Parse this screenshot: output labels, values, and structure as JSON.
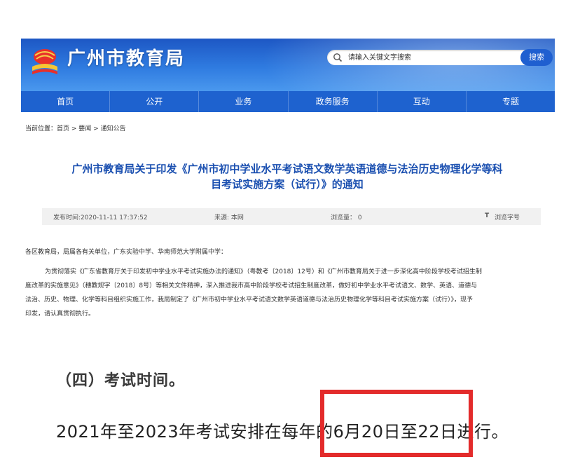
{
  "header": {
    "site_title": "广州市教育局",
    "search_placeholder": "请输入关键文字搜索",
    "search_button": "搜索"
  },
  "nav": {
    "items": [
      "首页",
      "公开",
      "业务",
      "政务服务",
      "互动",
      "专题"
    ]
  },
  "breadcrumb": {
    "prefix": "当前位置：",
    "items": [
      "首页",
      "要闻",
      "通知公告"
    ],
    "separator": " > "
  },
  "article": {
    "title_line1": "广州市教育局关于印发《广州市初中学业水平考试语文数学英语道德与法治历史物理化学等科",
    "title_line2": "目考试实施方案（试行）》的通知",
    "meta": {
      "publish_time": "发布时间:2020-11-11 17:37:52",
      "source": "来源: 本网",
      "views": "浏览量： 0",
      "font_icon": "T",
      "font_label": "浏览字号"
    },
    "salutation": "各区教育局，局属各有关单位，广东实验中学、华南师范大学附属中学：",
    "para1_line1": "为贯彻落实《广东省教育厅关于印发初中学业水平考试实施办法的通知》（粤教考〔2018〕12号）和《广州市教育局关于进一步深化高中阶段学校考试招生制",
    "para1_line2": "度改革的实施意见》（穗教规字〔2018〕8号）等相关文件精神，深入推进我市高中阶段学校考试招生制度改革，做好初中学业水平考试语文、数学、英语、道德与",
    "para1_line3": "法治、历史、物理、化学等科目组织实施工作，我局制定了《广州市初中学业水平考试语文数学英语道德与法治历史物理化学等科目考试实施方案（试行）》，现予",
    "para1_line4": "印发，请认真贯彻执行。"
  },
  "excerpt": {
    "heading": "（四）考试时间。",
    "schedule": "2021年至2023年考试安排在每年的6月20日至22日进行。"
  },
  "colors": {
    "banner": "#2f7be0",
    "nav": "#1e62cf",
    "title": "#1a4fb0",
    "highlight": "#e32b2b"
  }
}
